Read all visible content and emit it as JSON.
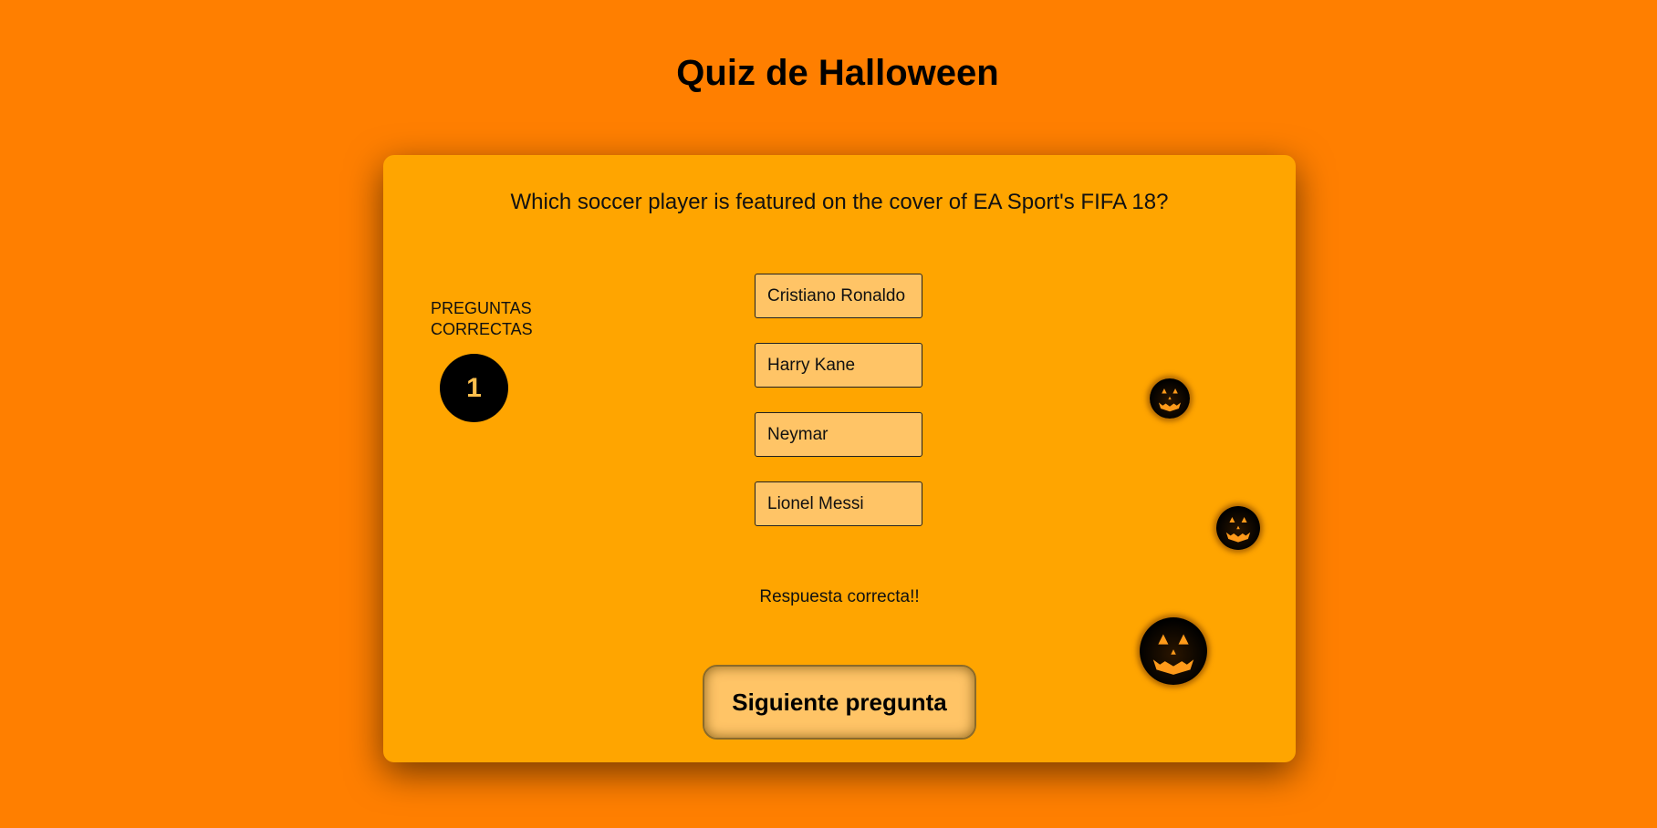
{
  "page": {
    "title": "Quiz de Halloween"
  },
  "quiz": {
    "question": "Which soccer player is featured on the cover of EA Sport's FIFA 18?",
    "score_label": "PREGUNTAS CORRECTAS",
    "score_value": "1",
    "options": [
      {
        "label": "Cristiano Ronaldo"
      },
      {
        "label": "Harry Kane"
      },
      {
        "label": "Neymar"
      },
      {
        "label": "Lionel Messi"
      }
    ],
    "feedback": "Respuesta correcta!!",
    "next_button_label": "Siguiente pregunta"
  },
  "decorations": {
    "icons": [
      "jack-o-lantern-icon",
      "jack-o-lantern-icon",
      "jack-o-lantern-icon"
    ]
  },
  "colors": {
    "background": "#ff7f00",
    "card": "#ffa500",
    "option_fill": "#ffc466",
    "score_circle": "#000000",
    "score_text": "#ffc04d"
  }
}
